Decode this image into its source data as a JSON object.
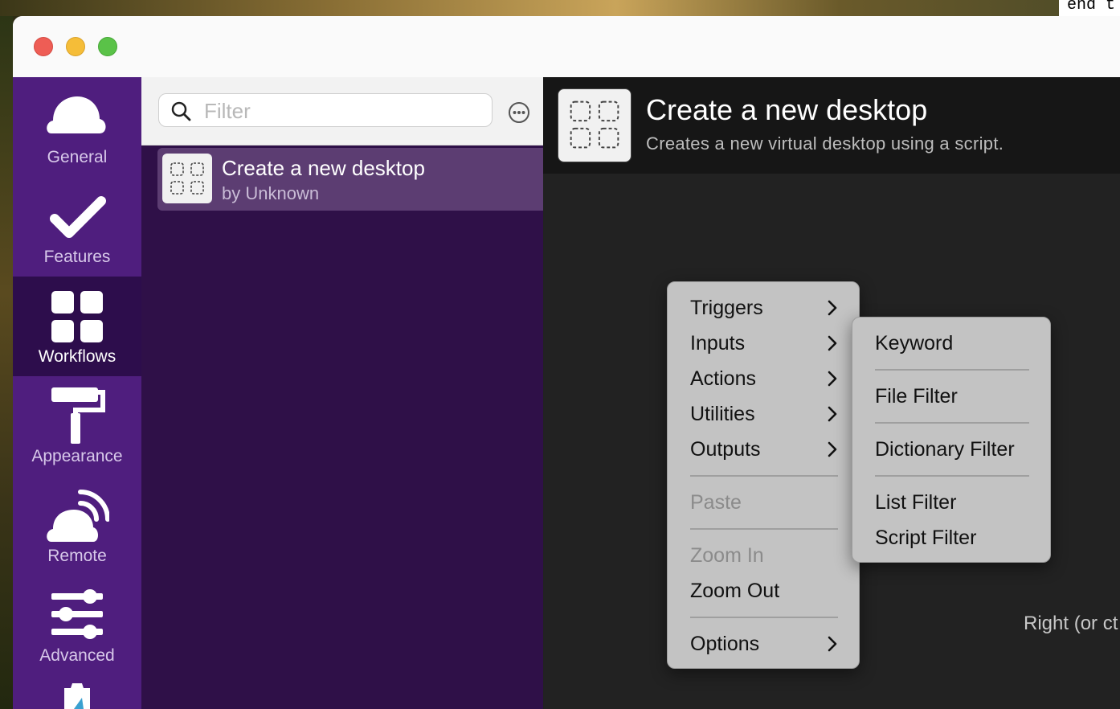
{
  "terminal_snippet": "end t",
  "sidebar": {
    "items": [
      {
        "label": "General",
        "icon": "cloud-icon"
      },
      {
        "label": "Features",
        "icon": "checkmark-icon"
      },
      {
        "label": "Workflows",
        "icon": "grid-icon"
      },
      {
        "label": "Appearance",
        "icon": "paint-roller-icon"
      },
      {
        "label": "Remote",
        "icon": "remote-icon"
      },
      {
        "label": "Advanced",
        "icon": "sliders-icon"
      }
    ],
    "active": "Workflows"
  },
  "search": {
    "placeholder": "Filter",
    "value": ""
  },
  "workflow_list": [
    {
      "name": "Create a new desktop",
      "author": "by Unknown"
    }
  ],
  "detail": {
    "title": "Create a new desktop",
    "description": "Creates a new virtual desktop using a script.",
    "hint": "Right (or ct"
  },
  "context_menu": {
    "items": [
      "Triggers",
      "Inputs",
      "Actions",
      "Utilities",
      "Outputs",
      "Paste",
      "Zoom In",
      "Zoom Out",
      "Options"
    ]
  },
  "submenu": {
    "items": [
      "Keyword",
      "File Filter",
      "Dictionary Filter",
      "List Filter",
      "Script Filter"
    ]
  },
  "colors": {
    "sidebar_bg": "#4f1e7e",
    "sidebar_active": "#2d0d4c",
    "list_bg": "#2f1048",
    "detail_bg": "#222222",
    "menu_bg": "#c3c3c3"
  }
}
